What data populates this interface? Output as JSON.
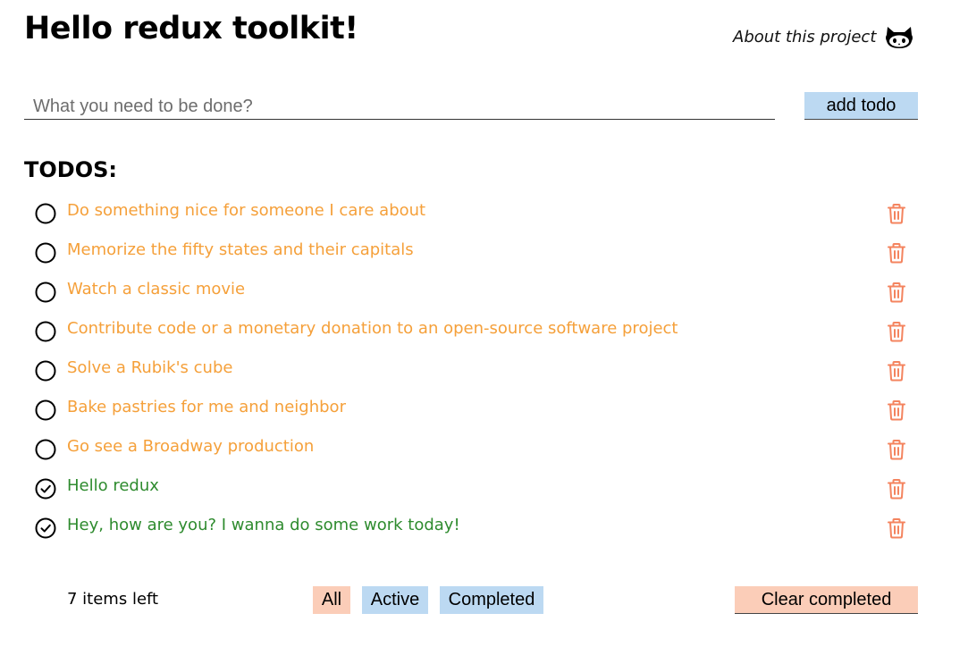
{
  "header": {
    "title": "Hello redux toolkit!",
    "about_link": "About this project",
    "github_icon": "github-octocat-icon"
  },
  "new_todo": {
    "placeholder": "What you need to be done?",
    "value": "",
    "add_label": "add todo"
  },
  "list": {
    "heading": "TODOS:",
    "items": [
      {
        "text": "Do something nice for someone I care about",
        "completed": false
      },
      {
        "text": "Memorize the fifty states and their capitals",
        "completed": false
      },
      {
        "text": "Watch a classic movie",
        "completed": false
      },
      {
        "text": "Contribute code or a monetary donation to an open-source software project",
        "completed": false
      },
      {
        "text": "Solve a Rubik's cube",
        "completed": false
      },
      {
        "text": "Bake pastries for me and neighbor",
        "completed": false
      },
      {
        "text": "Go see a Broadway production",
        "completed": false
      },
      {
        "text": "Hello redux",
        "completed": true
      },
      {
        "text": "Hey, how are you? I wanna do some work today!",
        "completed": true
      }
    ]
  },
  "footer": {
    "items_left": "7 items left",
    "filters": {
      "all": "All",
      "active": "Active",
      "completed": "Completed"
    },
    "selected_filter": "All",
    "clear_completed": "Clear completed"
  },
  "colors": {
    "active_text": "#f5a03a",
    "completed_text": "#2e8b2e",
    "trash": "#f4845f",
    "blue_button": "#bcd9f2",
    "peach_button": "#fbcdb8"
  },
  "icons": {
    "unchecked": "circle-icon",
    "checked": "check-circle-icon",
    "delete": "trash-icon"
  }
}
